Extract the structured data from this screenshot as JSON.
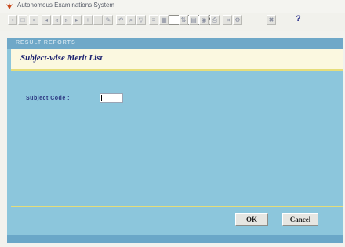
{
  "window": {
    "title": "Autonomous Examinations System"
  },
  "toolbar": {
    "buttons": [
      {
        "name": "tool-new-button",
        "icon": "new-icon",
        "glyph": "▫"
      },
      {
        "name": "tool-open-button",
        "icon": "open-icon",
        "glyph": "□"
      },
      {
        "name": "tool-save-button",
        "icon": "save-icon",
        "glyph": "▪"
      },
      {
        "name": "tool-first-button",
        "icon": "first-icon",
        "glyph": "◂"
      },
      {
        "name": "tool-prev-button",
        "icon": "prev-icon",
        "glyph": "◃"
      },
      {
        "name": "tool-next-button",
        "icon": "next-icon",
        "glyph": "▹"
      },
      {
        "name": "tool-last-button",
        "icon": "last-icon",
        "glyph": "▸"
      },
      {
        "name": "tool-add-button",
        "icon": "add-icon",
        "glyph": "+"
      },
      {
        "name": "tool-delete-button",
        "icon": "delete-icon",
        "glyph": "−"
      },
      {
        "name": "tool-edit-button",
        "icon": "edit-icon",
        "glyph": "✎"
      },
      {
        "name": "tool-undo-button",
        "icon": "undo-icon",
        "glyph": "↶"
      },
      {
        "name": "tool-find-button",
        "icon": "find-icon",
        "glyph": "⌕"
      },
      {
        "name": "tool-filter-button",
        "icon": "filter-icon",
        "glyph": "▽"
      },
      {
        "name": "tool-list-button",
        "icon": "list-icon",
        "glyph": "≡"
      },
      {
        "name": "tool-grid-button",
        "icon": "grid-icon",
        "glyph": "▦"
      },
      {
        "name": "tool-sort-button",
        "icon": "sort-icon",
        "glyph": "⇅"
      },
      {
        "name": "tool-report-button",
        "icon": "report-icon",
        "glyph": "▤"
      },
      {
        "name": "tool-preview-button",
        "icon": "preview-icon",
        "glyph": "◉"
      },
      {
        "name": "tool-print-button",
        "icon": "print-icon",
        "glyph": "⎙"
      },
      {
        "name": "tool-export-button",
        "icon": "export-icon",
        "glyph": "⇥"
      },
      {
        "name": "tool-settings-button",
        "icon": "settings-icon",
        "glyph": "⚙"
      },
      {
        "name": "tool-exit-button",
        "icon": "exit-icon",
        "glyph": "✖"
      }
    ],
    "help_label": "?"
  },
  "panel": {
    "section_label": "RESULT REPORTS",
    "title": "Subject-wise Merit List",
    "field_label": "Subject Code :",
    "field_value": ""
  },
  "actions": {
    "ok_label": "OK",
    "cancel_label": "Cancel"
  },
  "colors": {
    "panel_bg": "#8cc6dc",
    "header_strip": "#6fa8c8",
    "title_band": "#fbf8e0",
    "title_text": "#1d2370",
    "rule": "#e4dd7c"
  }
}
